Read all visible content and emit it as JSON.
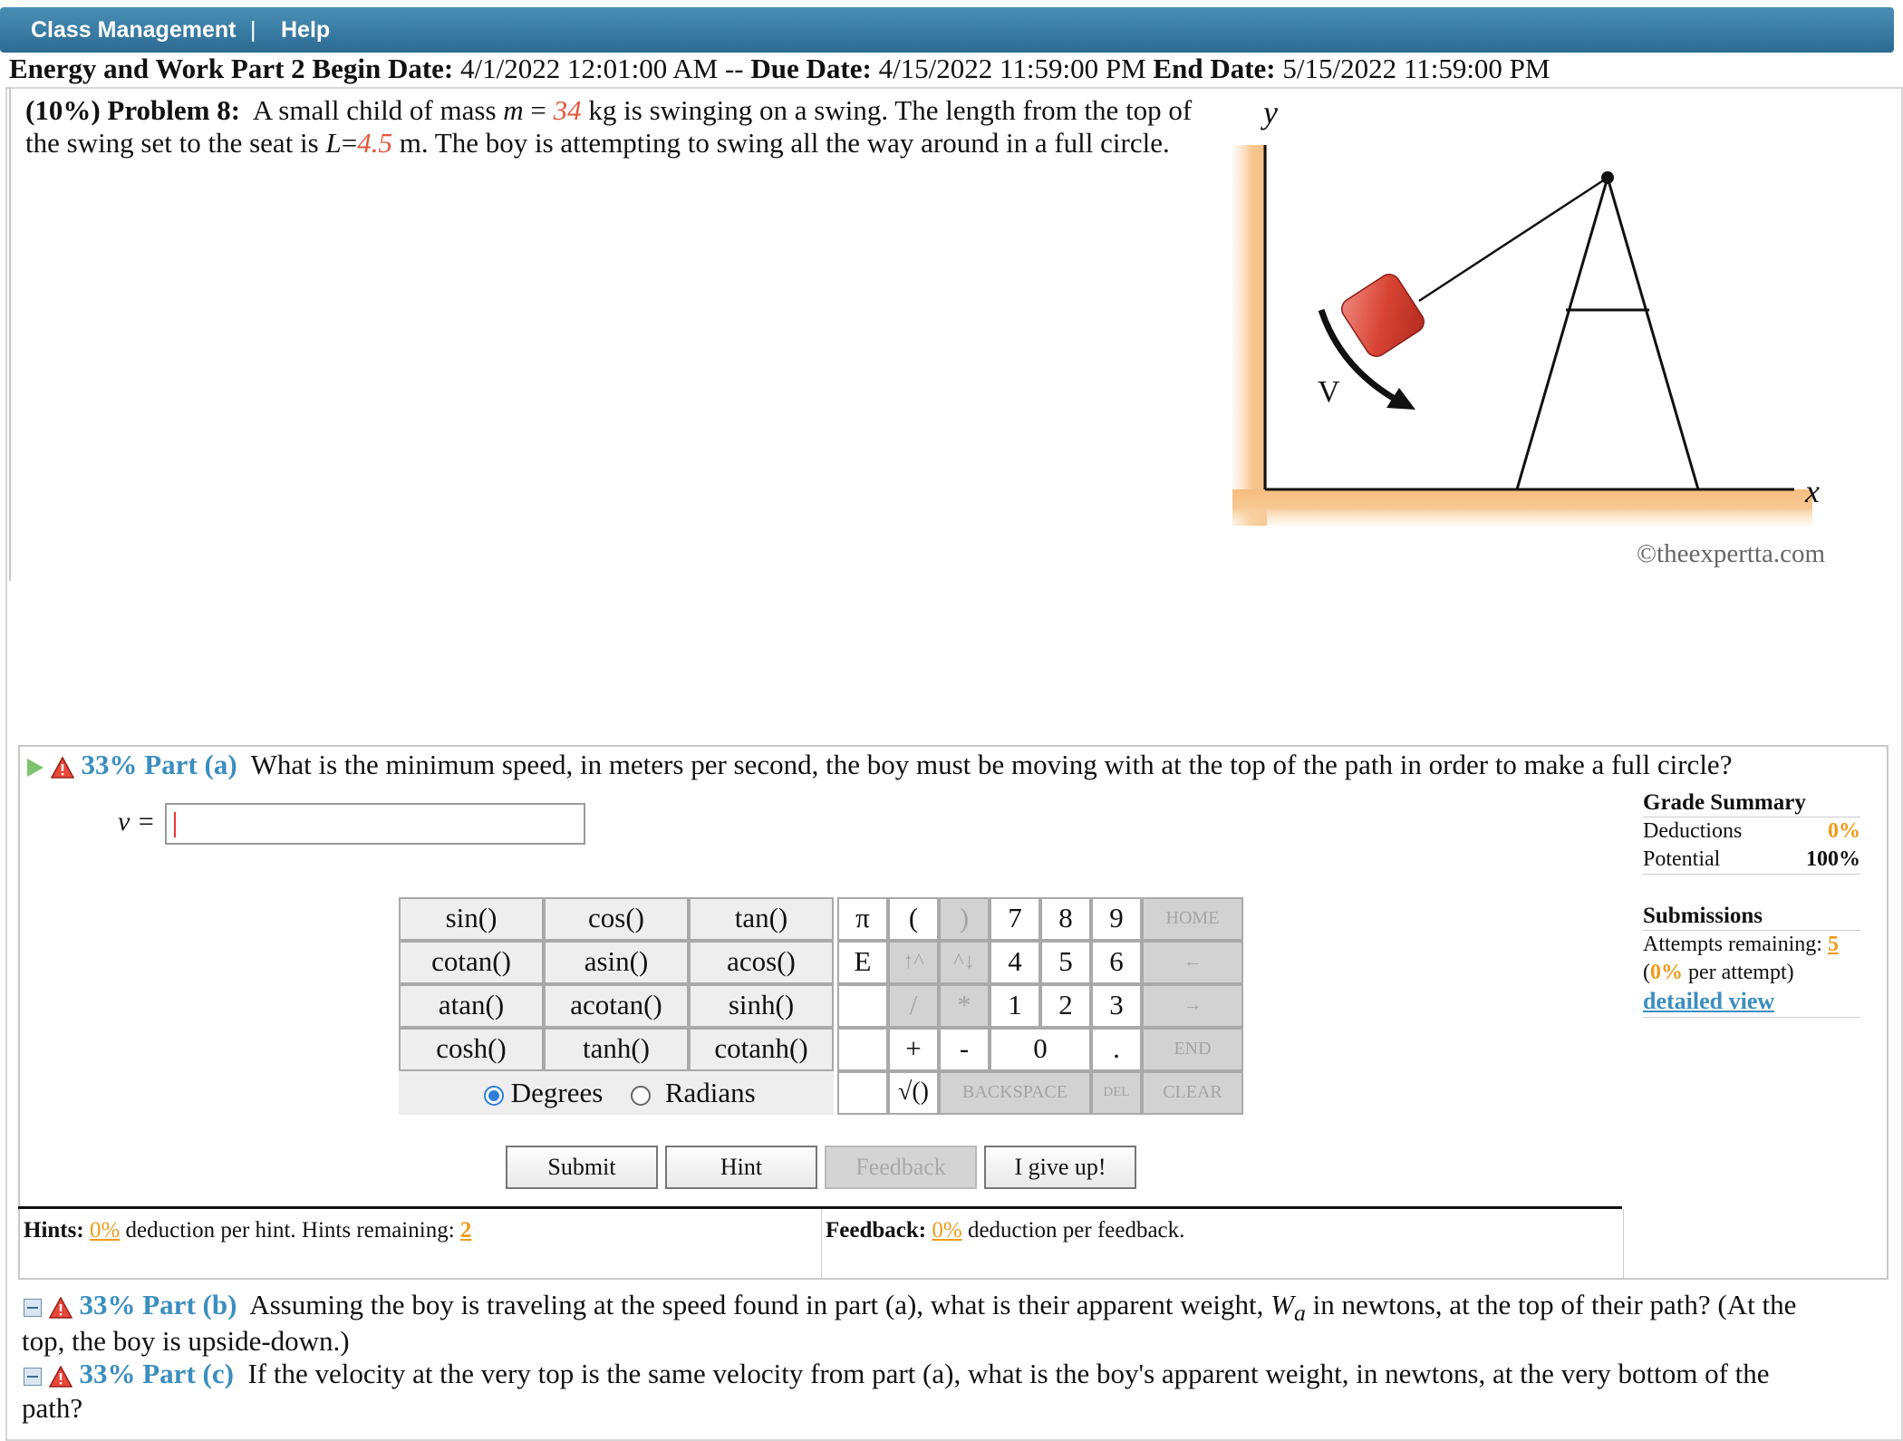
{
  "nav": {
    "class_management": "Class Management",
    "separator": "|",
    "help": "Help"
  },
  "assignment": {
    "title": "Energy and Work Part 2",
    "begin_label": "Begin Date:",
    "begin": "4/1/2022 12:01:00 AM",
    "sep": "--",
    "due_label": "Due Date:",
    "due": "4/15/2022 11:59:00 PM",
    "end_label": "End Date:",
    "end": "5/15/2022 11:59:00 PM"
  },
  "problem": {
    "weight": "(10%)",
    "label": "Problem 8:",
    "text1": "A small child of mass",
    "m_symbol": "m",
    "eq": "=",
    "m_value": "34",
    "text2": "kg is swinging on a swing. The length from the top of the swing set to the seat is",
    "L_symbol": "L",
    "L_value": "4.5",
    "text3": "m. The boy is attempting to swing all the way around in a full circle."
  },
  "figure": {
    "y_label": "y",
    "x_label": "x",
    "v_label": "V",
    "copyright": "©theexpertta.com"
  },
  "part_a": {
    "percent": "33%",
    "name": "Part (a)",
    "question": "What is the minimum speed, in meters per second, the boy must be moving with at the top of the path in order to make a full circle?",
    "var_label": "v =",
    "answer_value": ""
  },
  "keypad": {
    "functions": [
      "sin()",
      "cos()",
      "tan()",
      "cotan()",
      "asin()",
      "acos()",
      "atan()",
      "acotan()",
      "sinh()",
      "cosh()",
      "tanh()",
      "cotanh()"
    ],
    "symbols": [
      "π",
      "(",
      ")",
      "E",
      "↑^",
      "^↓",
      "/",
      "*",
      "+",
      "-",
      "√()"
    ],
    "digits": [
      "7",
      "8",
      "9",
      "4",
      "5",
      "6",
      "1",
      "2",
      "3",
      "0",
      "."
    ],
    "controls": [
      "HOME",
      "←",
      "→",
      "END",
      "BACKSPACE",
      "DEL",
      "CLEAR"
    ],
    "degrees": "Degrees",
    "radians": "Radians",
    "selected_mode": "Degrees"
  },
  "buttons": {
    "submit": "Submit",
    "hint": "Hint",
    "feedback": "Feedback",
    "give_up": "I give up!"
  },
  "grade_summary": {
    "title": "Grade Summary",
    "deductions_label": "Deductions",
    "deductions": "0%",
    "potential_label": "Potential",
    "potential": "100%",
    "submissions_title": "Submissions",
    "attempts_label": "Attempts remaining:",
    "attempts": "5",
    "per_attempt_open": "(",
    "per_attempt_value": "0%",
    "per_attempt_text": "per attempt)",
    "detailed_view": "detailed view"
  },
  "hints": {
    "label": "Hints:",
    "deduction": "0%",
    "text": "deduction per hint. Hints remaining:",
    "remaining": "2"
  },
  "feedback": {
    "label": "Feedback:",
    "deduction": "0%",
    "text": "deduction per feedback."
  },
  "part_b": {
    "percent": "33%",
    "name": "Part (b)",
    "question_start": "Assuming the boy is traveling at the speed found in part (a), what is their apparent weight,",
    "symbol": "W",
    "subscript": "a",
    "question_end": "in newtons, at the top of their path? (At the",
    "question_line2": "top, the boy is upside-down.)"
  },
  "part_c": {
    "percent": "33%",
    "name": "Part (c)",
    "question": "If the velocity at the very top is the same velocity from part (a), what is the boy's apparent weight, in newtons, at the very bottom of the",
    "question_line2": "path?"
  },
  "colors": {
    "nav_bar": "#2c6b93",
    "accent_red": "#e4563a",
    "part_blue": "#3b8ec0",
    "percent_orange": "#f09a1a"
  }
}
